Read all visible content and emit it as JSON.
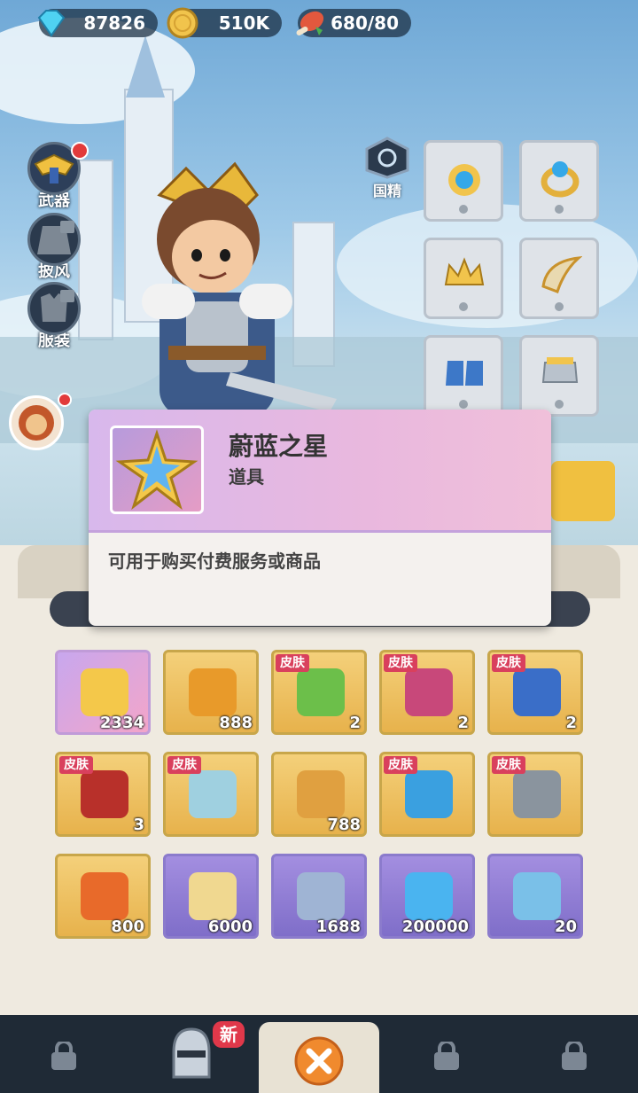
{
  "currency": {
    "gems": "87826",
    "gold": "510K",
    "stamina": "680/80"
  },
  "side_menu": [
    {
      "label": "武器",
      "locked": false,
      "badge": true
    },
    {
      "label": "披风",
      "locked": true,
      "badge": false
    },
    {
      "label": "服装",
      "locked": true,
      "badge": false
    }
  ],
  "equip_panel": {
    "reset_label": "国精"
  },
  "popup": {
    "title": "蔚蓝之星",
    "subtitle": "道具",
    "description": "可用于购买付费服务或商品"
  },
  "inventory": {
    "rows": [
      [
        {
          "style": "pink",
          "tag": "",
          "count": "2334",
          "art": "blue-star"
        },
        {
          "style": "gold",
          "tag": "",
          "count": "888",
          "art": "gold-orb"
        },
        {
          "style": "gold",
          "tag": "皮肤",
          "count": "2",
          "art": "green-hero"
        },
        {
          "style": "gold",
          "tag": "皮肤",
          "count": "2",
          "art": "pink-hero"
        },
        {
          "style": "gold",
          "tag": "皮肤",
          "count": "2",
          "art": "blue-hero"
        }
      ],
      [
        {
          "style": "gold",
          "tag": "皮肤",
          "count": "3",
          "art": "red-hero"
        },
        {
          "style": "gold",
          "tag": "皮肤",
          "count": "",
          "art": "bear-hero"
        },
        {
          "style": "gold",
          "tag": "",
          "count": "788",
          "art": "gold-hammer"
        },
        {
          "style": "gold",
          "tag": "皮肤",
          "count": "",
          "art": "blue-dagger"
        },
        {
          "style": "gold",
          "tag": "皮肤",
          "count": "",
          "art": "grey-hero"
        }
      ],
      [
        {
          "style": "gold",
          "tag": "",
          "count": "800",
          "art": "fire-gear"
        },
        {
          "style": "purple",
          "tag": "",
          "count": "6000",
          "art": "scroll"
        },
        {
          "style": "purple",
          "tag": "",
          "count": "1688",
          "art": "silver-hammer"
        },
        {
          "style": "purple",
          "tag": "",
          "count": "200000",
          "art": "blue-crystal"
        },
        {
          "style": "purple",
          "tag": "",
          "count": "20",
          "art": "ticket"
        }
      ]
    ]
  },
  "bottom_nav": {
    "new_badge": "新",
    "items": [
      "lock-icon",
      "knight-helmet-icon",
      "close-icon",
      "lock-icon",
      "lock-icon"
    ]
  },
  "colors": {
    "accent_gold": "#e7b24c",
    "rare_purple": "#7f6ec9",
    "skin_tag_red": "#d9405d"
  }
}
